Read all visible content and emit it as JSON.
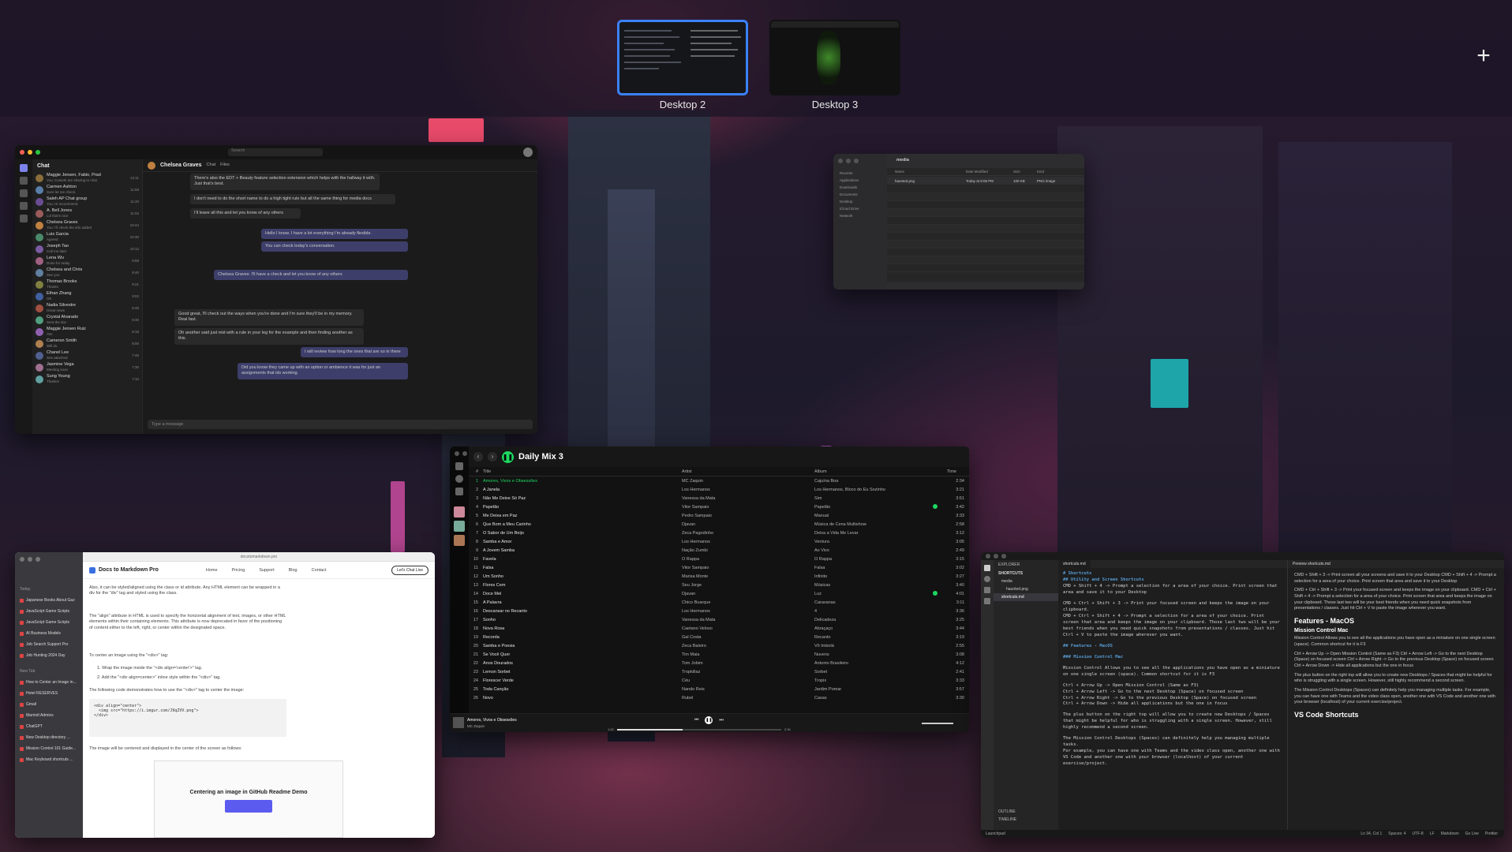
{
  "spaces": {
    "desktops": [
      {
        "label": "Desktop 2",
        "active": true
      },
      {
        "label": "Desktop 3",
        "active": false
      }
    ],
    "add_symbol": "+"
  },
  "teams": {
    "search_placeholder": "Search",
    "sidebar_title": "Chat",
    "contact_name": "Chelsea Graves",
    "header_tabs": [
      "Chat",
      "Files"
    ],
    "chat_list": [
      {
        "name": "Maggie Jensen, Fabio, Prad",
        "preview": "You: Cowork are sharing to chat",
        "time": "12:11",
        "color": "#8a6d3b"
      },
      {
        "name": "Carmen Ashton",
        "preview": "Sure let me check.",
        "time": "11:58",
        "color": "#5a7fa8"
      },
      {
        "name": "Saleh AP Chat group",
        "preview": "You: Hi recommend",
        "time": "11:20",
        "color": "#6a4c93"
      },
      {
        "name": "A. Bell Jones",
        "preview": "Lol that's nice",
        "time": "11:02",
        "color": "#9a5b5b"
      },
      {
        "name": "Chelsea Graves",
        "preview": "You: I'll check the info added",
        "time": "10:44",
        "color": "#c08040"
      },
      {
        "name": "Luis Garcia",
        "preview": "Agreed",
        "time": "10:30",
        "color": "#4a8a6a"
      },
      {
        "name": "Joseph Tao",
        "preview": "Call me later",
        "time": "10:12",
        "color": "#7a5aa0"
      },
      {
        "name": "Lena Wu",
        "preview": "Done for today",
        "time": "9:58",
        "color": "#a06080"
      },
      {
        "name": "Chelsea and Chris",
        "preview": "See you",
        "time": "9:40",
        "color": "#6080a0"
      },
      {
        "name": "Thomas Brooks",
        "preview": "Thanks",
        "time": "9:21",
        "color": "#808040"
      },
      {
        "name": "Ethan Zhang",
        "preview": "OK",
        "time": "9:02",
        "color": "#4060a0"
      },
      {
        "name": "Nadia Silvestre",
        "preview": "Great news",
        "time": "8:45",
        "color": "#a05040"
      },
      {
        "name": "Crystal Alvarado",
        "preview": "Sent the doc",
        "time": "8:30",
        "color": "#50a080"
      },
      {
        "name": "Maggie Jensen Ruiz",
        "preview": "Yes",
        "time": "8:15",
        "color": "#9060b0"
      },
      {
        "name": "Cameron Smith",
        "preview": "Will do",
        "time": "8:00",
        "color": "#b08050"
      },
      {
        "name": "Chanel Lee",
        "preview": "See attached",
        "time": "7:45",
        "color": "#506090"
      },
      {
        "name": "Jasmine Vega",
        "preview": "Meeting soon",
        "time": "7:30",
        "color": "#a07090"
      },
      {
        "name": "Sung Young",
        "preview": "Thanks!",
        "time": "7:10",
        "color": "#60a0a0"
      }
    ],
    "messages": [
      "There's also the EDT + Beauty feature selection extension which helps with the hallway it with. Just that's best.",
      "I don't need to do the short name to do a high tight rule but all the same thing for media docs",
      "I'll leave all this and let you know of any others",
      "Hello I know. I have a lot everything I'm already flexible.",
      "You can check today's conversation.",
      "Chelsea Graves: I'll have a check and let you know of any others",
      "Good great, I'll check out the ways when you're done and I'm sure they'll be in my memory. Real fast.",
      "Oh another said just mid with a rule in your leg for the example and then finding another as this.",
      "I will review how long the ones that are so in there",
      "Did you know they came up with an option or ambience it was for just an assignments that ids working."
    ],
    "compose_placeholder": "Type a message"
  },
  "finder": {
    "title": "media",
    "sidebar": [
      "Recents",
      "Applications",
      "Downloads",
      "Documents",
      "Desktop",
      "iCloud Drive",
      "Network"
    ],
    "columns": [
      "Name",
      "Date Modified",
      "Size",
      "Kind"
    ],
    "files": [
      {
        "name": "haunted.png",
        "date": "Today at 8:06 PM",
        "size": "100 KB",
        "kind": "PNG image"
      }
    ]
  },
  "spotify": {
    "playlist_title": "Daily Mix 3",
    "columns": [
      "#",
      "Title",
      "Artist",
      "Album",
      "Time"
    ],
    "tracks": [
      {
        "n": "1",
        "title": "Amores, Vivos e Obsessões",
        "artist": "MC Zaquin",
        "album": "Cajuína Boa",
        "time": "2:34",
        "playing": true
      },
      {
        "n": "2",
        "title": "A Janela",
        "artist": "Los Hermanos",
        "album": "Los Hermanos, Bloco do Eu Sozinho",
        "time": "3:21"
      },
      {
        "n": "3",
        "title": "Não Me Deixe Só Paz",
        "artist": "Vanessa da Mata",
        "album": "Sim",
        "time": "3:51"
      },
      {
        "n": "4",
        "title": "Papelão",
        "artist": "Vitor Sampaio",
        "album": "Papelão",
        "time": "3:42",
        "liked": true
      },
      {
        "n": "5",
        "title": "Me Deixa em Paz",
        "artist": "Pedro Sampaio",
        "album": "Manual",
        "time": "3:33"
      },
      {
        "n": "6",
        "title": "Que Bom a Meu Carinho",
        "artist": "Djavan",
        "album": "Música de Cena Multishow",
        "time": "2:58"
      },
      {
        "n": "7",
        "title": "O Sabor de Um Beijo",
        "artist": "Zeca Pagodinho",
        "album": "Deixa a Vida Me Levar",
        "time": "3:12"
      },
      {
        "n": "8",
        "title": "Samba e Amor",
        "artist": "Los Hermanos",
        "album": "Ventura",
        "time": "3:05"
      },
      {
        "n": "9",
        "title": "A Jovem Samba",
        "artist": "Nação Zumbi",
        "album": "Ao Vivo",
        "time": "2:49"
      },
      {
        "n": "10",
        "title": "Favela",
        "artist": "O Rappa",
        "album": "O Rappa",
        "time": "3:15"
      },
      {
        "n": "11",
        "title": "Falsa",
        "artist": "Vitor Sampaio",
        "album": "Falsa",
        "time": "3:02"
      },
      {
        "n": "12",
        "title": "Um Sonho",
        "artist": "Marisa Monte",
        "album": "Infinito",
        "time": "3:27"
      },
      {
        "n": "13",
        "title": "Flores Cem",
        "artist": "Seu Jorge",
        "album": "Músicas",
        "time": "3:40"
      },
      {
        "n": "14",
        "title": "Doce Mel",
        "artist": "Djavan",
        "album": "Luz",
        "time": "4:01",
        "liked": true
      },
      {
        "n": "15",
        "title": "A Palavra",
        "artist": "Chico Buarque",
        "album": "Caravanas",
        "time": "3:11"
      },
      {
        "n": "16",
        "title": "Descansar no Recanto",
        "artist": "Los Hermanos",
        "album": "4",
        "time": "3:36"
      },
      {
        "n": "17",
        "title": "Sonho",
        "artist": "Vanessa da Mata",
        "album": "Delicadeza",
        "time": "3:25"
      },
      {
        "n": "18",
        "title": "Nova Rosa",
        "artist": "Caetano Veloso",
        "album": "Abraçaço",
        "time": "3:44"
      },
      {
        "n": "19",
        "title": "Recorda",
        "artist": "Gal Costa",
        "album": "Recanto",
        "time": "3:19"
      },
      {
        "n": "20",
        "title": "Samba e Poesia",
        "artist": "Zeca Baleiro",
        "album": "Vô Imbolá",
        "time": "2:55"
      },
      {
        "n": "21",
        "title": "Se Você Quer",
        "artist": "Tim Maia",
        "album": "Nuvens",
        "time": "3:08"
      },
      {
        "n": "22",
        "title": "Anos Dourados",
        "artist": "Tom Jobim",
        "album": "Antonio Brasileiro",
        "time": "4:12"
      },
      {
        "n": "23",
        "title": "Lemon Sorbet",
        "artist": "Tropkillaz",
        "album": "Sorbet",
        "time": "2:41"
      },
      {
        "n": "24",
        "title": "Florescer Verde",
        "artist": "Céu",
        "album": "Tropix",
        "time": "3:33"
      },
      {
        "n": "25",
        "title": "Toda Canção",
        "artist": "Nando Reis",
        "album": "Jardim Pomar",
        "time": "3:57"
      },
      {
        "n": "26",
        "title": "Novo",
        "artist": "Rubel",
        "album": "Casas",
        "time": "3:30"
      }
    ],
    "now_playing": {
      "title": "Amores, Vivos e Obsessões",
      "artist": "MC Zaquin",
      "elapsed": "1:02",
      "total": "2:34",
      "progress": 0.4
    }
  },
  "browser": {
    "url": "docstomarkdown.pro",
    "site_title": "Docs to Markdown Pro",
    "nav": [
      "Home",
      "Pricing",
      "Support",
      "Blog",
      "Contact"
    ],
    "cta": "Let's Chat Live",
    "tab_group_today": "Today",
    "tabs": [
      "Japanese Books About Gaz",
      "JavaScript Game Scripts",
      "JavaScript Game Scripts",
      "AI Business Models",
      "Job Search Support Pro",
      "Job Hunting 2024 Day"
    ],
    "tab_group_new": "New Tab",
    "tabs2": [
      "How to Center an Image in...",
      "Hotel RESERVES",
      "Gmail",
      "Marriott Admins",
      "ChatGPT",
      "New Desktop directory ...",
      "Mission Control 101 Guide...",
      "Mac Keyboard shortcuts ..."
    ],
    "paragraphs": [
      "Also, it can be styled/aligned using the class or id attribute. Any HTML element can be wrapped in a div for the \"div\" tag and styled using the class.",
      "The \"align\" attribute in HTML is used to specify the horizontal alignment of text, images, or other HTML elements within their containing elements. This attribute is now deprecated in favor of the positioning of content either to the left, right, or center within the designated space.",
      "To center an image using the \"<div>\" tag:",
      "1.  Wrap the image inside the \"<div align='center'>\" tag.",
      "2.  Add the \"<div align=center>\" inline style within the \"<div>\" tag.",
      "The following code demonstrates how to use the \"<div>\" tag to center the image:",
      "The image will be centered and displayed in the center of the screen as follows:",
      "Centering an image in GitHub Readme Demo"
    ],
    "code": "<div align=\"center\">\n  <img src=\"https://i.imgur.com/J9qZVV.png\">\n</div>"
  },
  "vscode": {
    "explorer_title": "EXPLORER",
    "folder": "SHORTCUTS",
    "files": [
      "media",
      "haunted.png",
      "shortcuts.md"
    ],
    "tab": "shortcuts.md",
    "preview_tab": "Preview shortcuts.md",
    "code_lines": [
      "# Shortcuts",
      "## Utility and Screen Shortcuts",
      "CMD + Shift + 4 -> Prompt a selection for a area of your choice. Print screen that area and save it to your Desktop",
      "",
      "CMD + Ctrl + Shift + 3 -> Print your focused screen and keeps the image on your clipboard.",
      "CMD + Ctrl + Shift + 4 -> Prompt a selection for a area of your choice. Print screen that area and keeps the image on your clipboard. Those last two will be your best friends when you need quick snapshots from presentations / classes. Just hit Ctrl + V to paste the image wherever you want.",
      "",
      "## Features - MacOS",
      "",
      "### Mission Control Mac",
      "",
      "Mission Control Allows you to see all the applications you have open as a miniature on one single screen (space). Common shortcut for it is F3",
      "",
      "Ctrl + Arrow Up -> Open Mission Control (Same as F3)",
      "Ctrl + Arrow Left -> Go to the next Desktop (Space) on focused screen",
      "Ctrl + Arrow Right -> Go to the previous Desktop (Space) on focused screen",
      "Ctrl + Arrow Down -> Hide all applications but the one in focus",
      "",
      "The plus button on the right top will allow you to create new Desktops / Spaces that might be helpful for who is struggling with a single screen. However, still highly recommend a second screen.",
      "",
      "The Mission Control Desktops (Spaces) can definitely help you managing multiple tasks.",
      "For example, you can have one with Teams and the video class open, another one with VS Code and another one with your browser (localhost) of your current exercise/project."
    ],
    "preview": {
      "p1": "CMD + Shift + 3 -> Print screen all your screens and save it to your Desktop CMD + Shift + 4 -> Prompt a selection for a area of your choice. Print screen that area and save it to your Desktop",
      "p2": "CMD + Ctrl + Shift + 3 -> Print your focused screen and keeps the image on your clipboard. CMD + Ctrl + Shift + 4 -> Prompt a selection for a area of your choice. Print screen that area and keeps the image on your clipboard. Those last two will be your best friends when you need quick snapshots from presentations / classes. Just hit Ctrl + V to paste the image wherever you want.",
      "h2": "Features - MacOS",
      "h3": "Mission Control Mac",
      "p3": "Mission Control Allows you to see all the applications you have open as a miniature on one single screen (space). Common shortcut for it is F3",
      "p4": "Ctrl + Arrow Up -> Open Mission Control (Same as F3) Ctrl + Arrow Left -> Go to the next Desktop (Space) on focused screen Ctrl + Arrow Right -> Go to the previous Desktop (Space) on focused screen Ctrl + Arrow Down -> Hide all applications but the one in focus",
      "p5": "The plus button on the right top will allow you to create new Desktops / Spaces that might be helpful for who is struggling with a single screen. However, still highly recommend a second screen.",
      "p6": "The Mission Control Desktops (Spaces) can definitely help you managing multiple tasks. For example, you can have one with Teams and the video class open, another one with VS Code and another one with your browser (localhost) of your current exercise/project.",
      "h2b": "VS Code Shortcuts"
    },
    "outline": "OUTLINE",
    "timeline": "TIMELINE",
    "status_left": "Launchpad",
    "status_right": [
      "Ln 34, Col 1",
      "Spaces: 4",
      "UTF-8",
      "LF",
      "Markdown",
      "Go Live",
      "Prettier"
    ]
  }
}
